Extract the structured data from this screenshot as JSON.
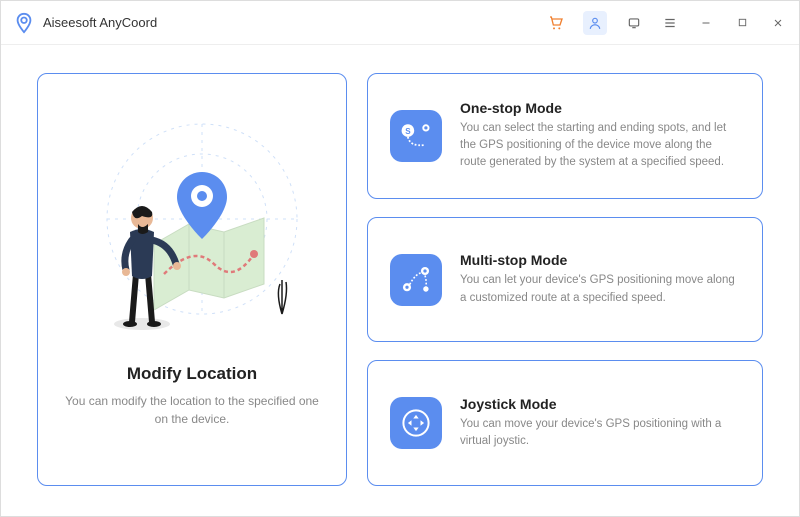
{
  "app": {
    "title": "Aiseesoft AnyCoord"
  },
  "titlebar": {
    "cart_icon": "cart-icon",
    "user_icon": "user-icon",
    "feedback_icon": "feedback-icon",
    "menu_icon": "menu-icon",
    "minimize_icon": "minimize-icon",
    "maximize_icon": "maximize-icon",
    "close_icon": "close-icon"
  },
  "main": {
    "modify": {
      "title": "Modify Location",
      "desc": "You can modify the location to the specified one on the device."
    },
    "modes": [
      {
        "title": "One-stop Mode",
        "desc": "You can select the starting and ending spots, and let the GPS positioning of the device move along the route generated by the system at a specified speed."
      },
      {
        "title": "Multi-stop Mode",
        "desc": "You can let your device's GPS positioning move along a customized route at a specified speed."
      },
      {
        "title": "Joystick Mode",
        "desc": "You can move your device's GPS positioning with a virtual joystic."
      }
    ]
  },
  "colors": {
    "accent": "#5b8def",
    "cart": "#f08030"
  }
}
